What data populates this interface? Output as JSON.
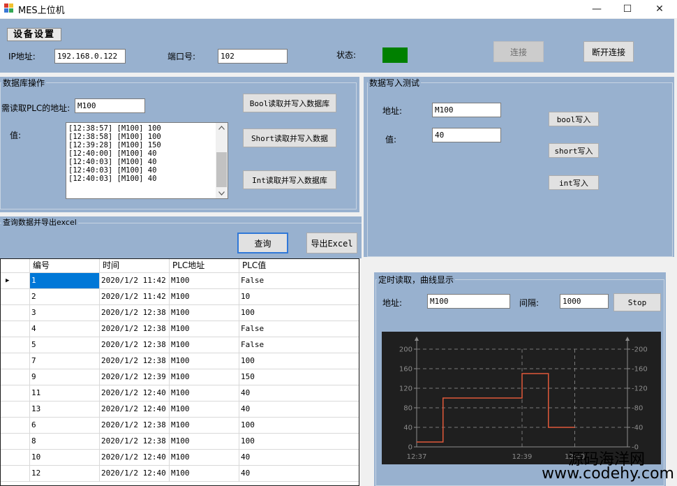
{
  "window": {
    "title": "MES上位机",
    "controls": {
      "minimize": "—",
      "maximize": "☐",
      "close": "✕"
    }
  },
  "device": {
    "section_title": "设备设置",
    "ip_label": "IP地址:",
    "ip_value": "192.168.0.122",
    "port_label": "端口号:",
    "port_value": "102",
    "status_label": "状态:",
    "status_color": "#008000",
    "connect_button": "连接",
    "disconnect_button": "断开连接"
  },
  "db_ops": {
    "title": "数据库操作",
    "address_label": "需读取PLC的地址:",
    "address_value": "M100",
    "value_label": "值:",
    "log_lines": [
      "[12:38:57] [M100] 100",
      "[12:38:58] [M100] 100",
      "[12:39:28] [M100] 150",
      "[12:40:00] [M100] 40",
      "[12:40:03] [M100] 40",
      "[12:40:03] [M100] 40",
      "[12:40:03] [M100] 40"
    ],
    "bool_button": "Bool读取并写入数据库",
    "short_button": "Short读取并写入数据",
    "int_button": "Int读取并写入数据库"
  },
  "write_test": {
    "title": "数据写入测试",
    "address_label": "地址:",
    "address_value": "M100",
    "value_label": "值:",
    "value_value": "40",
    "bool_button": "bool写入",
    "short_button": "short写入",
    "int_button": "int写入"
  },
  "query": {
    "title": "查询数据并导出excel",
    "query_button": "查询",
    "export_button": "导出Excel",
    "columns": [
      "编号",
      "时间",
      "PLC地址",
      "PLC值"
    ],
    "rows": [
      [
        "1",
        "2020/1/2 11:42",
        "M100",
        "False"
      ],
      [
        "2",
        "2020/1/2 11:42",
        "M100",
        "10"
      ],
      [
        "3",
        "2020/1/2 12:38",
        "M100",
        "100"
      ],
      [
        "4",
        "2020/1/2 12:38",
        "M100",
        "False"
      ],
      [
        "5",
        "2020/1/2 12:38",
        "M100",
        "False"
      ],
      [
        "7",
        "2020/1/2 12:38",
        "M100",
        "100"
      ],
      [
        "9",
        "2020/1/2 12:39",
        "M100",
        "150"
      ],
      [
        "11",
        "2020/1/2 12:40",
        "M100",
        "40"
      ],
      [
        "13",
        "2020/1/2 12:40",
        "M100",
        "40"
      ],
      [
        "6",
        "2020/1/2 12:38",
        "M100",
        "100"
      ],
      [
        "8",
        "2020/1/2 12:38",
        "M100",
        "100"
      ],
      [
        "10",
        "2020/1/2 12:40",
        "M100",
        "40"
      ],
      [
        "12",
        "2020/1/2 12:40",
        "M100",
        "40"
      ]
    ],
    "current_row_marker": "▶"
  },
  "timer": {
    "title": "定时读取，曲线显示",
    "address_label": "地址:",
    "address_value": "M100",
    "interval_label": "间隔:",
    "interval_value": "1000",
    "stop_button": "Stop"
  },
  "chart_data": {
    "type": "line",
    "x": [
      "12:37",
      "12:37:30",
      "12:37:30",
      "12:38:30",
      "12:38:30",
      "12:39:00",
      "12:39:00",
      "12:39:30",
      "12:39:30",
      "12:40:00"
    ],
    "y": [
      10,
      10,
      100,
      100,
      100,
      100,
      150,
      150,
      40,
      40
    ],
    "x_min": "12:37",
    "x_max": "12:41",
    "x_ticks": [
      "12:37",
      "12:39",
      "12:40"
    ],
    "y_ticks": [
      0,
      40,
      80,
      120,
      160,
      200
    ],
    "ylim": [
      0,
      200
    ],
    "line_color": "#e0583a",
    "background": "#1f1f1f",
    "grid": true
  },
  "watermark": {
    "cn": "源码海洋网",
    "url": "www.codehy.com"
  }
}
